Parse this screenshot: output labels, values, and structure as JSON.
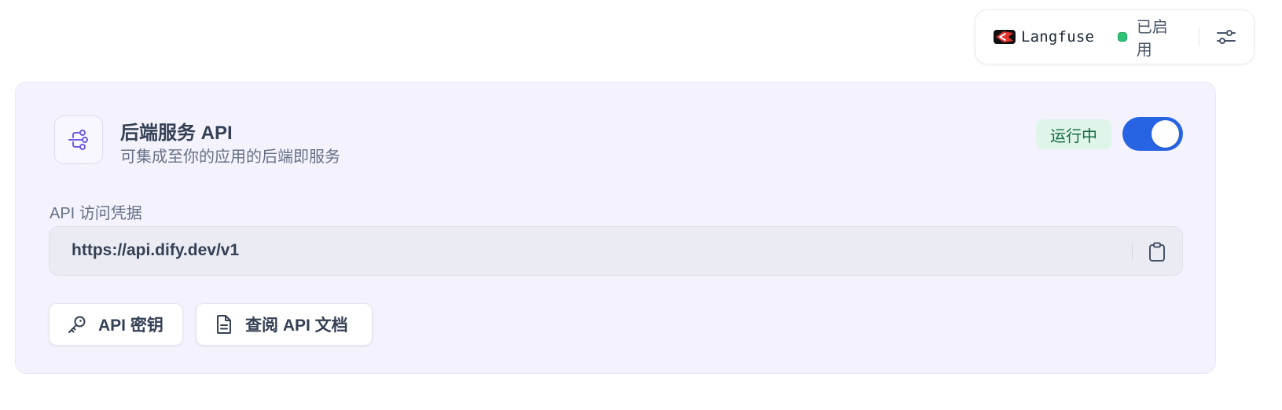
{
  "tracing": {
    "provider_name": "Langfuse",
    "provider_logo_icon": "langfuse-logo-icon",
    "status_text": "已启用",
    "status_color": "#32c275",
    "settings_icon": "settings-sliders-icon"
  },
  "service": {
    "icon": "api-flow-icon",
    "title": "后端服务 API",
    "subtitle": "可集成至你的应用的后端即服务",
    "status_badge": "运行中",
    "enabled": true,
    "accent_color": "#2764e4",
    "credentials_label": "API 访问凭据",
    "api_base_url": "https://api.dify.dev/v1",
    "copy_icon": "clipboard-icon"
  },
  "actions": {
    "api_keys_label": "API 密钥",
    "api_keys_icon": "key-icon",
    "docs_label": "查阅 API 文档",
    "docs_icon": "document-icon"
  }
}
